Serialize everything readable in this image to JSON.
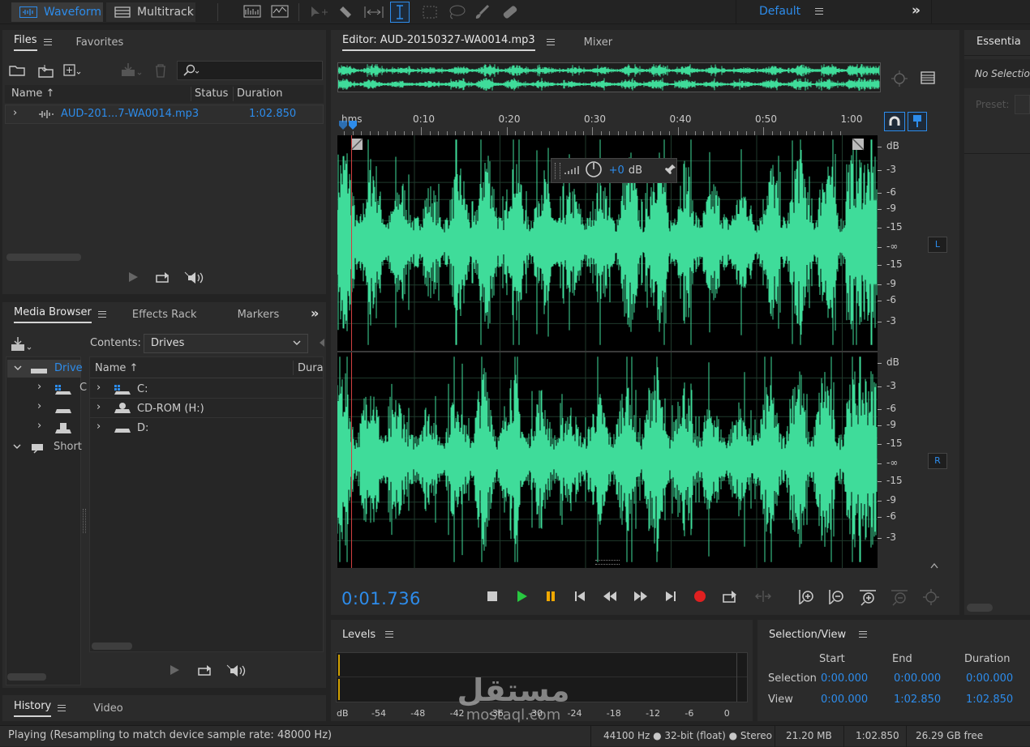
{
  "topbar": {
    "waveform_label": "Waveform",
    "multitrack_label": "Multitrack",
    "workspace_label": "Default",
    "more_label": "»"
  },
  "files": {
    "tab_files": "Files",
    "tab_favorites": "Favorites",
    "col_name": "Name",
    "col_status": "Status",
    "col_duration": "Duration",
    "row_name": "AUD-201...7-WA0014.mp3",
    "row_duration": "1:02.850"
  },
  "media": {
    "tab_media": "Media Browser",
    "tab_effects": "Effects Rack",
    "tab_markers": "Markers",
    "contents_label": "Contents:",
    "contents_value": "Drives",
    "tree_drives": "Drive",
    "tree_shortcuts": "Short",
    "col_name": "Name",
    "col_duration": "Dura",
    "items": [
      "C:",
      "CD-ROM (H:)",
      "D:"
    ]
  },
  "history": {
    "tab_history": "History",
    "tab_video": "Video"
  },
  "editor": {
    "tab_editor": "Editor: AUD-20150327-WA0014.mp3",
    "tab_mixer": "Mixer",
    "ruler_unit": "hms",
    "ruler_ticks": [
      "0:10",
      "0:20",
      "0:30",
      "0:40",
      "0:50",
      "1:00"
    ],
    "db_scale": [
      "dB",
      "-3",
      "-6",
      "-9",
      "-15",
      "-∞",
      "-15",
      "-9",
      "-6",
      "-3"
    ],
    "channel_left": "L",
    "channel_right": "R",
    "hud_gain": "+0",
    "hud_unit": "dB",
    "time_display": "0:01.736",
    "waveform_color": "#3fdc9a"
  },
  "essential": {
    "tab": "Essentia",
    "no_selection": "No Selectio",
    "preset_label": "Preset:"
  },
  "levels": {
    "tab": "Levels",
    "scale": [
      "dB",
      "-54",
      "-48",
      "-42",
      "-36",
      "-30",
      "-24",
      "-18",
      "-12",
      "-6",
      "0"
    ]
  },
  "selection": {
    "tab": "Selection/View",
    "col_start": "Start",
    "col_end": "End",
    "col_duration": "Duration",
    "rows": [
      {
        "label": "Selection",
        "start": "0:00.000",
        "end": "0:00.000",
        "duration": "0:00.000"
      },
      {
        "label": "View",
        "start": "0:00.000",
        "end": "1:02.850",
        "duration": "1:02.850"
      }
    ]
  },
  "statusbar": {
    "message": "Playing (Resampling to match device sample rate: 48000 Hz)",
    "format": "44100 Hz ● 32-bit (float) ● Stereo",
    "size": "21.20 MB",
    "duration": "1:02.850",
    "free": "26.29 GB free"
  },
  "watermark": {
    "arabic": "مستقل",
    "latin": "mostaql.com"
  }
}
